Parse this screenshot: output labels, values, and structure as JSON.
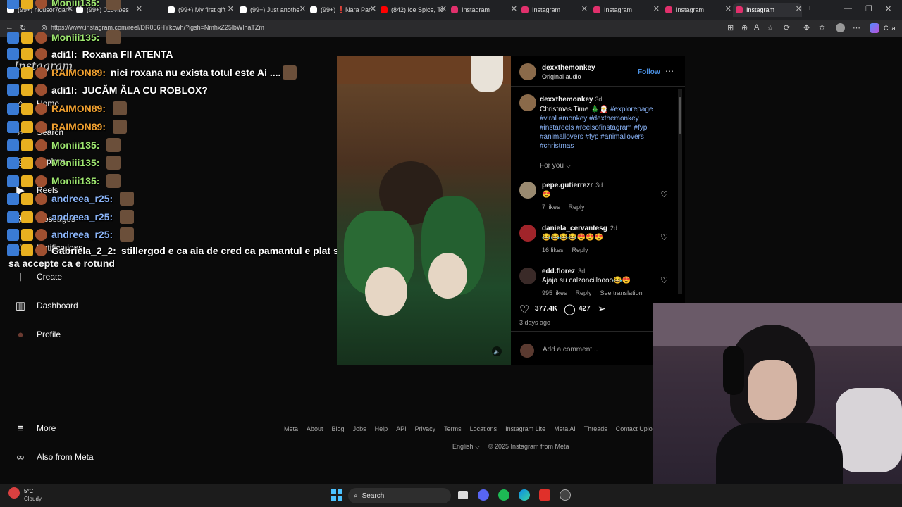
{
  "browser": {
    "tabs": [
      {
        "label": "(99+) nicusor7gam",
        "color": "#ffffff"
      },
      {
        "label": "(99+) 018vibes",
        "color": "#ffffff"
      },
      {
        "label": "(99+) My first gift",
        "color": "#ffffff"
      },
      {
        "label": "(99+) Just anothe",
        "color": "#ffffff"
      },
      {
        "label": "(99+) ❗Nara Par",
        "color": "#ffffff"
      },
      {
        "label": "(842) Ice Spice, To",
        "color": "#ff0000"
      },
      {
        "label": "Instagram",
        "color": "#e1306c"
      },
      {
        "label": "Instagram",
        "color": "#e1306c"
      },
      {
        "label": "Instagram",
        "color": "#e1306c"
      },
      {
        "label": "Instagram",
        "color": "#e1306c"
      },
      {
        "label": "Instagram",
        "color": "#e1306c"
      }
    ],
    "url": "https://www.instagram.com/reel/DR056HYkcwh/?igsh=NmhxZ25lbWlhaTZm",
    "chat_button": "Chat"
  },
  "sidebar": {
    "logo": "Instagram",
    "items": [
      {
        "label": "Home",
        "icon": "home-icon"
      },
      {
        "label": "Search",
        "icon": "search-icon"
      },
      {
        "label": "Explore",
        "icon": "explore-icon"
      },
      {
        "label": "Reels",
        "icon": "reels-icon"
      },
      {
        "label": "Messages",
        "icon": "messages-icon"
      },
      {
        "label": "Notifications",
        "icon": "heart-icon"
      },
      {
        "label": "Create",
        "icon": "plus-icon"
      },
      {
        "label": "Dashboard",
        "icon": "dashboard-icon"
      },
      {
        "label": "Profile",
        "icon": "avatar"
      },
      {
        "label": "More",
        "icon": "menu-icon"
      },
      {
        "label": "Also from Meta",
        "icon": "meta-icon"
      }
    ]
  },
  "chat": [
    {
      "user": "Moniii135:",
      "msg": "",
      "color": "#9fe870"
    },
    {
      "user": "Moniii135:",
      "msg": "",
      "color": "#9fe870"
    },
    {
      "user": "adi1l:",
      "msg": "Roxana FII ATENTA",
      "color": "#ffffff"
    },
    {
      "user": "RAIMON89:",
      "msg": "nici roxana nu exista totul este Ai ....",
      "color": "#f0a030"
    },
    {
      "user": "adi1l:",
      "msg": "JUCĂM ĂLA CU ROBLOX?",
      "color": "#ffffff"
    },
    {
      "user": "RAIMON89:",
      "msg": "",
      "color": "#f0a030"
    },
    {
      "user": "RAIMON89:",
      "msg": "",
      "color": "#f0a030"
    },
    {
      "user": "Moniii135:",
      "msg": "",
      "color": "#9fe870"
    },
    {
      "user": "Moniii135:",
      "msg": "",
      "color": "#9fe870"
    },
    {
      "user": "Moniii135:",
      "msg": "",
      "color": "#9fe870"
    },
    {
      "user": "andreea_r25:",
      "msg": "",
      "color": "#8ab4f8"
    },
    {
      "user": "andreea_r25:",
      "msg": "",
      "color": "#8ab4f8"
    },
    {
      "user": "andreea_r25:",
      "msg": "",
      "color": "#8ab4f8"
    },
    {
      "user": "Gabriela_2_2:",
      "msg": "stillergod e ca aia de cred ca pamantul e plat si nu vor",
      "color": "#ffffff"
    }
  ],
  "chat_wrap": "sa accepte ca e rotund",
  "post": {
    "author": "dexxthemonkey",
    "audio": "Original audio",
    "follow": "Follow",
    "caption_author": "dexxthemonkey",
    "caption_time": "3d",
    "caption_text": "Christmas Time 🎄🎅",
    "hashtags_line1": "#explorepage",
    "hashtags_line2": "#viral #monkey #dexthemonkey",
    "hashtags_line3": "#instareels #reelsofinstagram #fyp",
    "hashtags_line4": "#animallovers #fyp #animallovers",
    "hashtags_line5": "#christmas",
    "for_you": "For you",
    "likes": "377.4K",
    "comments_count": "427",
    "time_ago": "3 days ago",
    "add_comment_placeholder": "Add a comment..."
  },
  "comments": [
    {
      "user": "pepe.gutierrezr",
      "time": "3d",
      "text": "😍",
      "likes": "7 likes",
      "reply": "Reply",
      "extra": ""
    },
    {
      "user": "daniela_cervantesg",
      "time": "2d",
      "text": "😂😂😂😂😍😍😍",
      "likes": "16 likes",
      "reply": "Reply",
      "extra": ""
    },
    {
      "user": "edd.florez",
      "time": "3d",
      "text": "Ajaja su calzoncilloooo😂😍",
      "likes": "995 likes",
      "reply": "Reply",
      "extra": "See translation"
    }
  ],
  "footer": {
    "links": [
      "Meta",
      "About",
      "Blog",
      "Jobs",
      "Help",
      "API",
      "Privacy",
      "Terms",
      "Locations",
      "Instagram Lite",
      "Meta AI",
      "Threads",
      "Contact Uploading"
    ],
    "language": "English",
    "copyright": "© 2025 Instagram from Meta"
  },
  "taskbar": {
    "weather_temp": "5°C",
    "weather_desc": "Cloudy",
    "search": "Search"
  }
}
